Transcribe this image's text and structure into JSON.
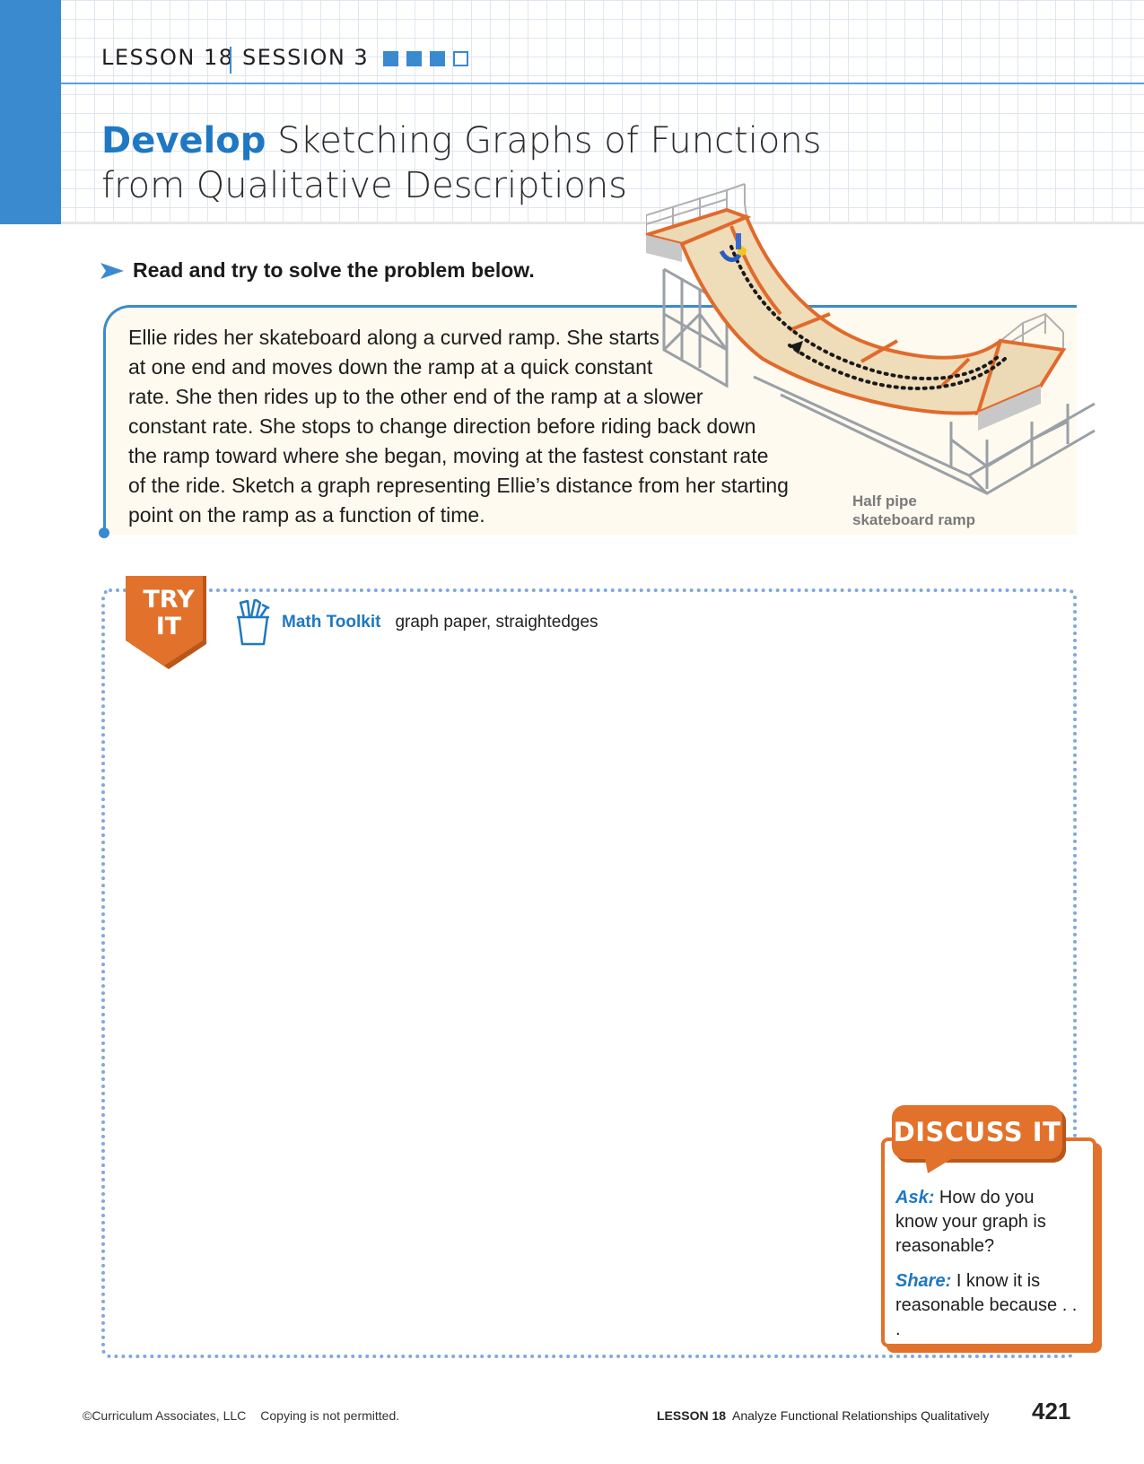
{
  "header": {
    "lesson": "LESSON 18",
    "session": "SESSION 3",
    "progress": {
      "completed": 3,
      "total": 4
    },
    "title_strong": "Develop",
    "title_line1": " Sketching Graphs of Functions",
    "title_line2": "from Qualitative Descriptions"
  },
  "instruction": "Read and try to solve the problem below.",
  "problem": {
    "lines": [
      "Ellie rides her skateboard along a curved ramp. She starts",
      "at one end and moves down the ramp at a quick constant",
      "rate. She then rides up to the other end of the ramp at a slower",
      "constant rate. She stops to change direction before riding back down",
      "the ramp toward where she began, moving at the fastest constant rate",
      "of the ride. Sketch a graph representing Ellie’s distance from her starting",
      "point on the ramp as a function of time."
    ]
  },
  "image_caption": {
    "line1": "Half pipe",
    "line2": "skateboard ramp"
  },
  "try_it": {
    "line1": "TRY",
    "line2": "IT",
    "toolkit_label": "Math Toolkit",
    "toolkit_items": "graph paper, straightedges"
  },
  "discuss": {
    "title": "DISCUSS IT",
    "ask_label": "Ask:",
    "ask_text": "How do you know your graph is reasonable?",
    "share_label": "Share:",
    "share_text": "I know it is reasonable because . . ."
  },
  "footer": {
    "copyright": "©Curriculum Associates, LLC",
    "notice": "Copying is not permitted.",
    "lesson_label": "LESSON 18",
    "lesson_title": "Analyze Functional Relationships Qualitatively",
    "page_number": "421"
  },
  "colors": {
    "brand_blue": "#3a8ad0",
    "title_blue": "#1f78c1",
    "accent_orange": "#e2722b"
  }
}
